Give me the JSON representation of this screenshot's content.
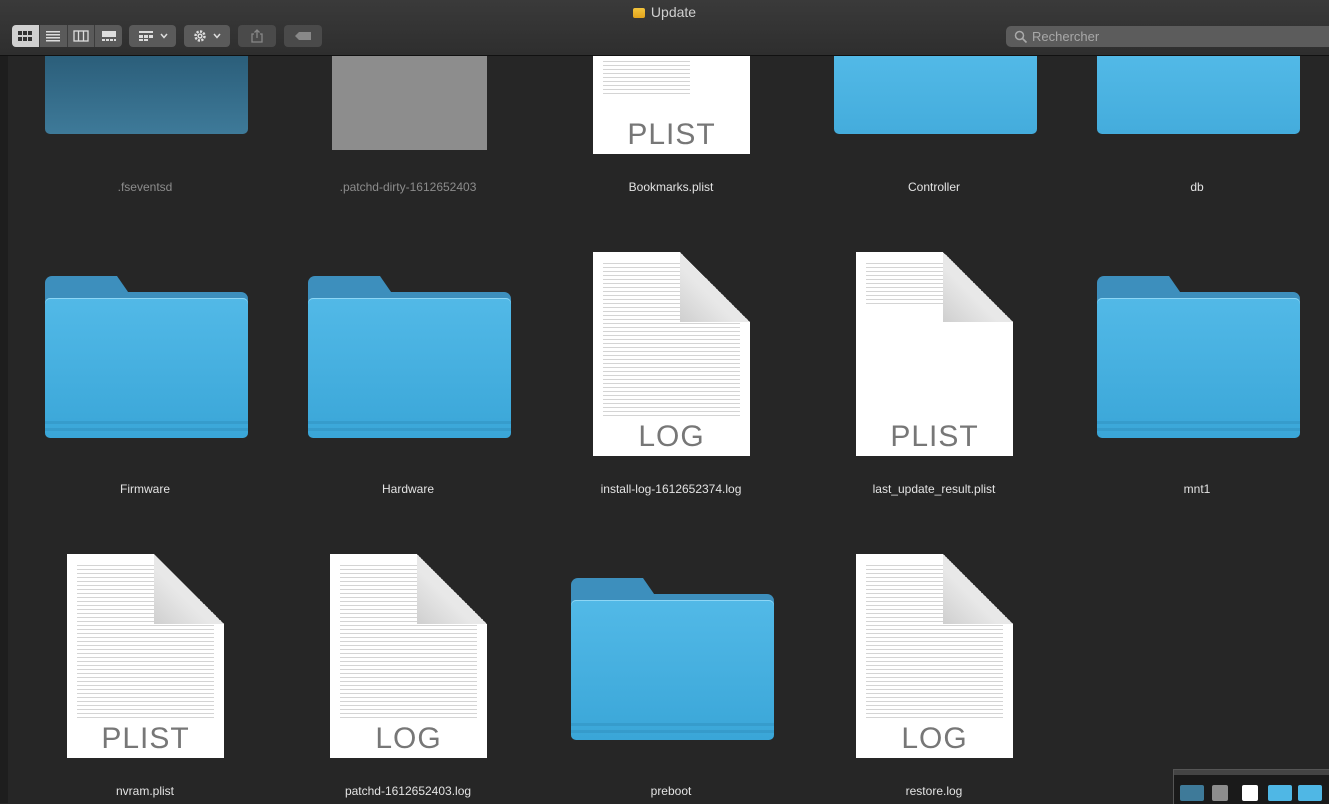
{
  "window": {
    "title": "Update"
  },
  "toolbar": {
    "view_modes": [
      "icon-view",
      "list-view",
      "column-view",
      "gallery-view"
    ],
    "active_view": "icon-view",
    "group_icon": "group-grid-icon",
    "action_icon": "gear-icon",
    "share_icon": "share-icon",
    "tag_icon": "tag-icon"
  },
  "search": {
    "placeholder": "Rechercher"
  },
  "colors": {
    "folder": "#4fb7e5",
    "background": "#262626"
  },
  "files": [
    {
      "name": ".fseventsd",
      "kind": "folder-dark"
    },
    {
      "name": ".patchd-dirty-1612652403",
      "kind": "grey"
    },
    {
      "name": "Bookmarks.plist",
      "kind": "doc",
      "ext": "PLIST"
    },
    {
      "name": "Controller",
      "kind": "folder"
    },
    {
      "name": "db",
      "kind": "folder"
    },
    {
      "name": "Firmware",
      "kind": "folder"
    },
    {
      "name": "Hardware",
      "kind": "folder"
    },
    {
      "name": "install-log-1612652374.log",
      "kind": "doc",
      "ext": "LOG"
    },
    {
      "name": "last_update_result.plist",
      "kind": "doc",
      "ext": "PLIST"
    },
    {
      "name": "mnt1",
      "kind": "folder"
    },
    {
      "name": "nvram.plist",
      "kind": "doc",
      "ext": "PLIST"
    },
    {
      "name": "patchd-1612652403.log",
      "kind": "doc",
      "ext": "LOG"
    },
    {
      "name": "preboot",
      "kind": "folder"
    },
    {
      "name": "restore.log",
      "kind": "doc",
      "ext": "LOG"
    }
  ]
}
